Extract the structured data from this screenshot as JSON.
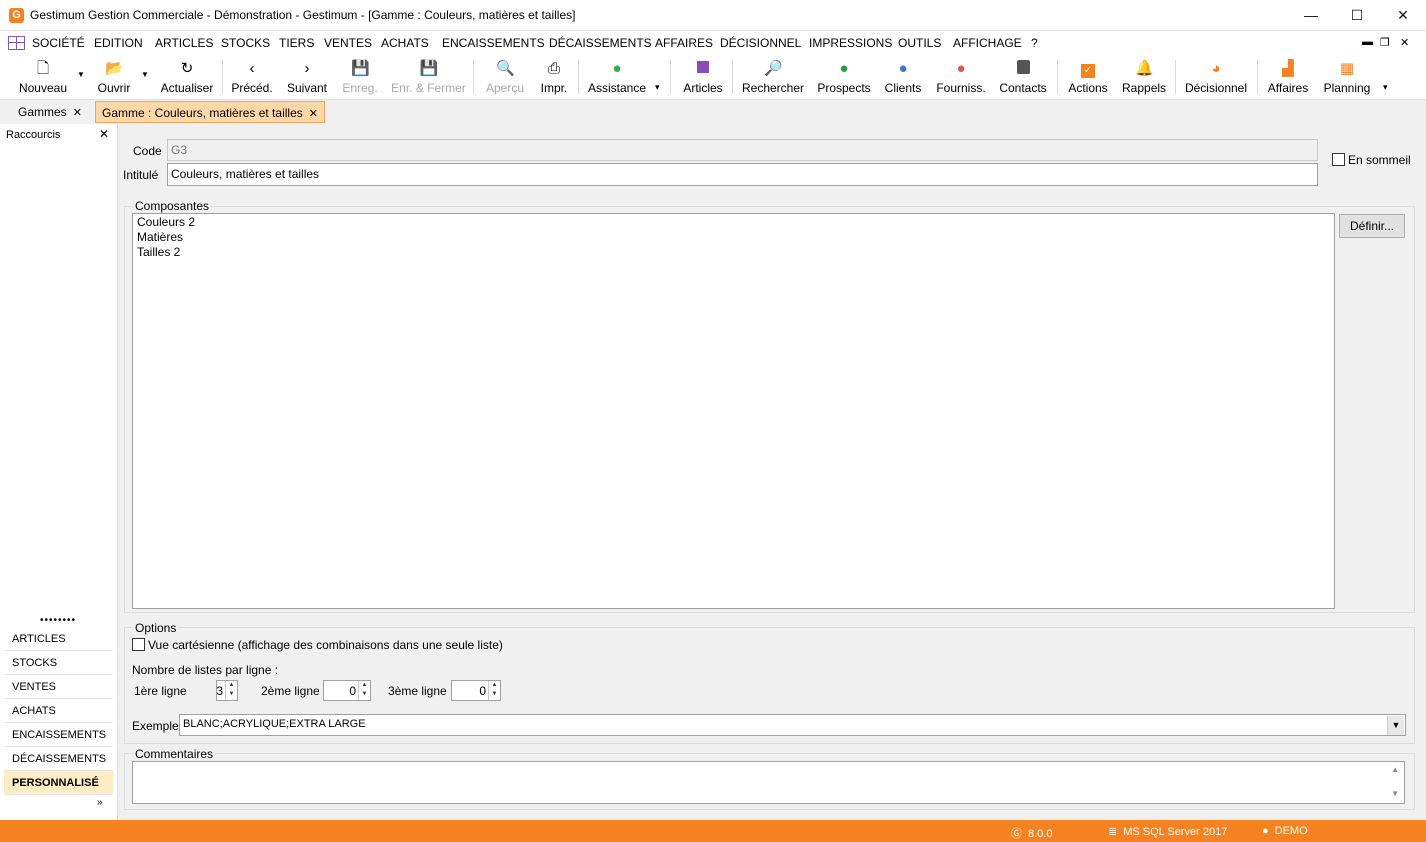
{
  "window": {
    "title": "Gestimum Gestion Commerciale - Démonstration - Gestimum - [Gamme : Couleurs, matières et tailles]",
    "app_icon": "G",
    "minimize": "—",
    "maximize": "☐",
    "close": "✕"
  },
  "menu": {
    "items": [
      "SOCIÉTÉ",
      "EDITION",
      "ARTICLES",
      "STOCKS",
      "TIERS",
      "VENTES",
      "ACHATS",
      "ENCAISSEMENTS",
      "DÉCAISSEMENTS",
      "AFFAIRES",
      "DÉCISIONNEL",
      "IMPRESSIONS",
      "OUTILS",
      "AFFICHAGE",
      "?"
    ],
    "mdi_minimize": "▬",
    "mdi_restore": "❐",
    "mdi_close": "✕"
  },
  "toolbar": {
    "nouveau": "Nouveau",
    "ouvrir": "Ouvrir",
    "actualiser": "Actualiser",
    "preced": "Précéd.",
    "suivant": "Suivant",
    "enreg": "Enreg.",
    "enr_fermer": "Enr. & Fermer",
    "apercu": "Aperçu",
    "impr": "Impr.",
    "assistance": "Assistance",
    "articles": "Articles",
    "rechercher": "Rechercher",
    "prospects": "Prospects",
    "clients": "Clients",
    "fourniss": "Fourniss.",
    "contacts": "Contacts",
    "actions": "Actions",
    "rappels": "Rappels",
    "decisionnel": "Décisionnel",
    "affaires": "Affaires",
    "planning": "Planning"
  },
  "tabs": [
    {
      "label": "Gammes",
      "close": "✕"
    },
    {
      "label": "Gamme : Couleurs, matières et tailles",
      "close": "✕"
    }
  ],
  "sidebar": {
    "title": "Raccourcis",
    "close": "✕",
    "grip": "••••••••",
    "items": [
      "ARTICLES",
      "STOCKS",
      "VENTES",
      "ACHATS",
      "ENCAISSEMENTS",
      "DÉCAISSEMENTS",
      "PERSONNALISÉ"
    ],
    "more": "»"
  },
  "form": {
    "code_label": "Code",
    "code_value": "G3",
    "intitule_label": "Intitulé",
    "intitule_value": "Couleurs, matières et tailles",
    "en_sommeil_label": "En sommeil",
    "composantes_title": "Composantes",
    "composantes": [
      "Couleurs 2",
      "Matières",
      "Tailles 2"
    ],
    "definir_button": "Définir...",
    "options_title": "Options",
    "vue_cartesienne_label": "Vue cartésienne (affichage des combinaisons dans une seule liste)",
    "nombre_listes_label": "Nombre de listes par ligne :",
    "ligne1_label": "1ère ligne",
    "ligne1_value": "3",
    "ligne2_label": "2ème ligne",
    "ligne2_value": "0",
    "ligne3_label": "3ème ligne",
    "ligne3_value": "0",
    "exemple_label": "Exemple",
    "exemple_value": "BLANC;ACRYLIQUE;EXTRA LARGE",
    "commentaires_title": "Commentaires"
  },
  "status": {
    "version": "8.0.0",
    "database": "MS SQL Server 2017",
    "user": "DEMO"
  },
  "colors": {
    "brand_orange": "#f58220",
    "active_tab": "#fcd7a8",
    "active_sidebar": "#fdecc4"
  }
}
